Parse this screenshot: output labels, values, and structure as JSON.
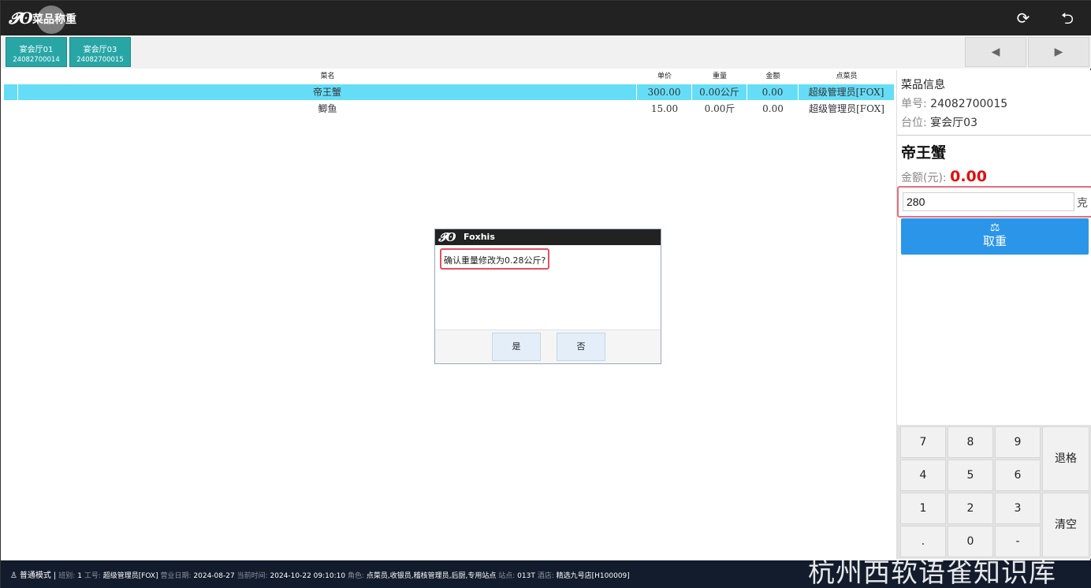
{
  "app": {
    "logo": "𝓣ʘ",
    "title": "菜品称重"
  },
  "top_icons": {
    "refresh": "⟳",
    "back": "⮌"
  },
  "tabs": [
    {
      "name": "宴会厅01",
      "no": "24082700014"
    },
    {
      "name": "宴会厅03",
      "no": "24082700015"
    }
  ],
  "nav": {
    "prev": "◀",
    "next": "▶"
  },
  "grid": {
    "headers": {
      "name": "菜名",
      "price": "单价",
      "weight": "重量",
      "amount": "金额",
      "staff": "点菜员"
    },
    "rows": [
      {
        "name": "帝王蟹",
        "price": "300.00",
        "weight": "0.00公斤",
        "amount": "0.00",
        "staff": "超级管理员[FOX]"
      },
      {
        "name": "鲫鱼",
        "price": "15.00",
        "weight": "0.00斤",
        "amount": "0.00",
        "staff": "超级管理员[FOX]"
      }
    ]
  },
  "panel": {
    "heading": "菜品信息",
    "order_label": "单号:",
    "order_value": "24082700015",
    "table_label": "台位:",
    "table_value": "宴会厅03",
    "dish": "帝王蟹",
    "amount_label": "金额(元):",
    "amount_value": "0.00",
    "weight_input": "280",
    "weight_unit": "克",
    "cancel_icon": "⚖",
    "cancel_label": "取重"
  },
  "keypad": {
    "digits": [
      "7",
      "8",
      "9",
      "4",
      "5",
      "6",
      "1",
      "2",
      "3",
      ".",
      "0",
      "-"
    ],
    "backspace": "退格",
    "clear": "清空"
  },
  "status": {
    "mode_icon": "♙",
    "mode": "普通模式",
    "shift_label": "班别:",
    "shift": "1",
    "worker_label": "工号:",
    "worker": "超级管理员[FOX]",
    "bizdate_label": "营业日期:",
    "bizdate": "2024-08-27",
    "now_label": "当前时间:",
    "now": "2024-10-22 09:10:10",
    "role_label": "角色:",
    "role": "点菜员,收银员,稽核管理员,后厨,专用站点",
    "site_label": "站点:",
    "site": "013T",
    "store_label": "酒店:",
    "store": "精选九号店[H100009]",
    "watermark": "杭州西软语雀知识库"
  },
  "dialog": {
    "logo": "𝓣ʘ",
    "title": "Foxhis",
    "message": "确认重量修改为0.28公斤?",
    "yes": "是",
    "no": "否"
  }
}
